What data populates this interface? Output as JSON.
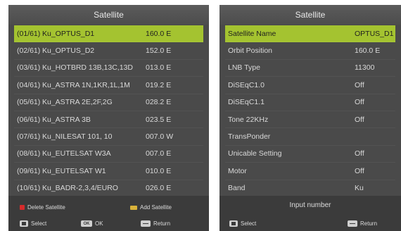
{
  "left_panel": {
    "title": "Satellite",
    "rows": [
      {
        "index": "(01/61)",
        "name": "Ku_OPTUS_D1",
        "position": "160.0 E"
      },
      {
        "index": "(02/61)",
        "name": "Ku_OPTUS_D2",
        "position": "152.0 E"
      },
      {
        "index": "(03/61)",
        "name": "Ku_HOTBRD 13B,13C,13D",
        "position": "013.0 E"
      },
      {
        "index": "(04/61)",
        "name": "Ku_ASTRA 1N,1KR,1L,1M",
        "position": "019.2 E"
      },
      {
        "index": "(05/61)",
        "name": "Ku_ASTRA 2E,2F,2G",
        "position": "028.2 E"
      },
      {
        "index": "(06/61)",
        "name": "Ku_ASTRA 3B",
        "position": "023.5 E"
      },
      {
        "index": "(07/61)",
        "name": "Ku_NILESAT 101, 10",
        "position": "007.0 W"
      },
      {
        "index": "(08/61)",
        "name": "Ku_EUTELSAT W3A",
        "position": "007.0 E"
      },
      {
        "index": "(09/61)",
        "name": "Ku_EUTELSAT W1",
        "position": "010.0 E"
      },
      {
        "index": "(10/61)",
        "name": "Ku_BADR-2,3,4/EURO",
        "position": "026.0 E"
      }
    ],
    "legend": {
      "delete_label": "Delete Satellite",
      "add_label": "Add Satellite",
      "select_label": "Select",
      "ok_label": "OK",
      "ok_key": "OK",
      "return_label": "Return"
    }
  },
  "right_panel": {
    "title": "Satellite",
    "rows": [
      {
        "label": "Satellite Name",
        "value": "OPTUS_D1"
      },
      {
        "label": "Orbit Position",
        "value": "160.0 E"
      },
      {
        "label": "LNB Type",
        "value": "11300"
      },
      {
        "label": "DiSEqC1.0",
        "value": "Off"
      },
      {
        "label": "DiSEqC1.1",
        "value": "Off"
      },
      {
        "label": "Tone 22KHz",
        "value": "Off"
      },
      {
        "label": "TransPonder",
        "value": ""
      },
      {
        "label": "Unicable Setting",
        "value": "Off"
      },
      {
        "label": "Motor",
        "value": "Off"
      },
      {
        "label": "Band",
        "value": "Ku"
      }
    ],
    "input_hint": "Input number",
    "legend": {
      "select_label": "Select",
      "return_label": "Return"
    }
  },
  "colors": {
    "highlight": "#a4c330",
    "panel_bg": "#4a4a4a",
    "legend_bg": "#3b3b3b",
    "red_key": "#d62b2b",
    "yellow_key": "#d9b23a"
  },
  "icons": [
    "red-key-icon",
    "yellow-key-icon",
    "navigation-pad-icon",
    "ok-key-icon",
    "return-key-icon"
  ]
}
